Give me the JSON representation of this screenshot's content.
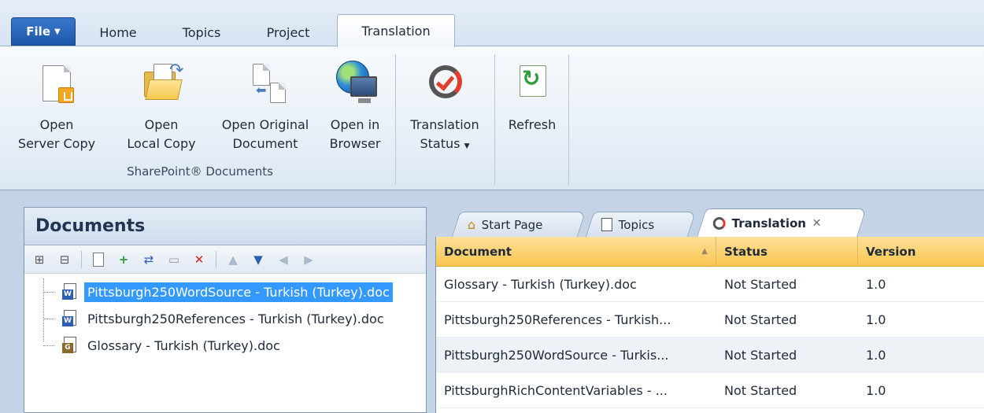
{
  "ribbon_tabs": {
    "file": "File",
    "home": "Home",
    "topics": "Topics",
    "project": "Project",
    "translation": "Translation"
  },
  "ribbon": {
    "open_server_copy": [
      "Open",
      "Server Copy"
    ],
    "open_local_copy": [
      "Open",
      "Local Copy"
    ],
    "open_original_document": [
      "Open Original",
      "Document"
    ],
    "open_in_browser": [
      "Open in",
      "Browser"
    ],
    "translation_status": [
      "Translation",
      "Status"
    ],
    "refresh": "Refresh",
    "group_label": "SharePoint® Documents"
  },
  "documents_panel": {
    "title": "Documents",
    "tree": [
      {
        "label": "Pittsburgh250WordSource - Turkish (Turkey).doc",
        "selected": true
      },
      {
        "label": "Pittsburgh250References - Turkish (Turkey).doc",
        "selected": false
      },
      {
        "label": "Glossary - Turkish (Turkey).doc",
        "selected": false
      }
    ]
  },
  "doc_tabs": {
    "start_page": "Start Page",
    "topics": "Topics",
    "translation": "Translation"
  },
  "grid": {
    "headers": {
      "document": "Document",
      "status": "Status",
      "version": "Version"
    },
    "rows": [
      {
        "document": "Glossary - Turkish (Turkey).doc",
        "status": "Not Started",
        "version": "1.0"
      },
      {
        "document": "Pittsburgh250References - Turkish...",
        "status": "Not Started",
        "version": "1.0"
      },
      {
        "document": "Pittsburgh250WordSource - Turkis...",
        "status": "Not Started",
        "version": "1.0"
      },
      {
        "document": "PittsburghRichContentVariables - ...",
        "status": "Not Started",
        "version": "1.0"
      }
    ]
  },
  "colors": {
    "accent_blue": "#3399ff",
    "grid_header": "#f8c54f",
    "file_button": "#1d57a8"
  }
}
